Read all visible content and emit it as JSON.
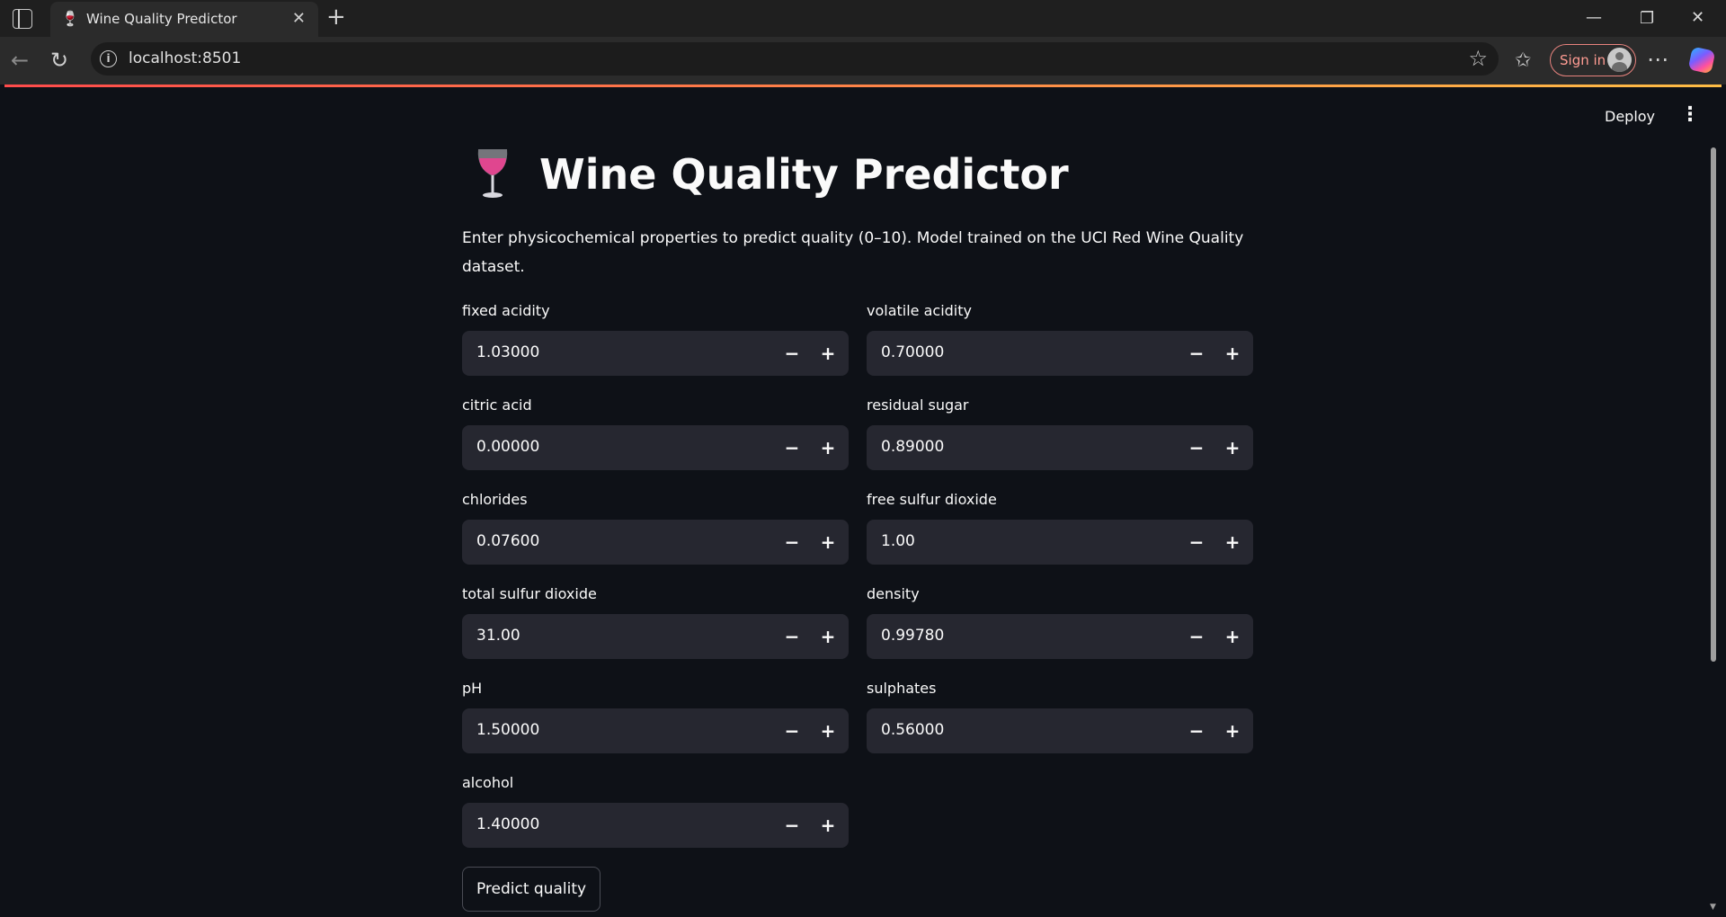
{
  "browser": {
    "tab_title": "Wine Quality Predictor",
    "url": "localhost:8501",
    "signin_label": "Sign in"
  },
  "app": {
    "deploy_label": "Deploy",
    "title": "Wine Quality Predictor",
    "title_emoji": "wine-glass",
    "description": "Enter physicochemical properties to predict quality (0–10). Model trained on the UCI Red Wine Quality dataset.",
    "predict_label": "Predict quality",
    "accent_color": "#ff4b4b",
    "fields": [
      {
        "label": "fixed acidity",
        "value": "1.03000"
      },
      {
        "label": "volatile acidity",
        "value": "0.70000"
      },
      {
        "label": "citric acid",
        "value": "0.00000"
      },
      {
        "label": "residual sugar",
        "value": "0.89000"
      },
      {
        "label": "chlorides",
        "value": "0.07600"
      },
      {
        "label": "free sulfur dioxide",
        "value": "1.00"
      },
      {
        "label": "total sulfur dioxide",
        "value": "31.00"
      },
      {
        "label": "density",
        "value": "0.99780"
      },
      {
        "label": "pH",
        "value": "1.50000"
      },
      {
        "label": "sulphates",
        "value": "0.56000"
      },
      {
        "label": "alcohol",
        "value": "1.40000"
      }
    ]
  }
}
